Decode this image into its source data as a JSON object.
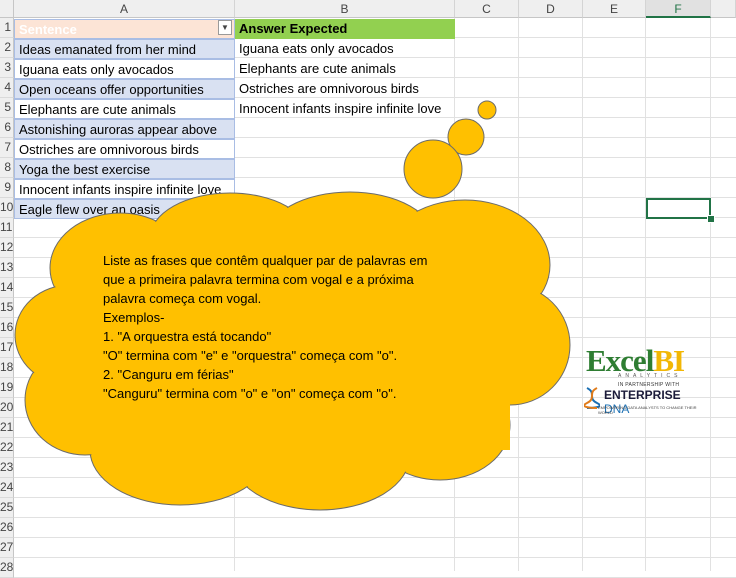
{
  "columns": [
    "A",
    "B",
    "C",
    "D",
    "E",
    "F"
  ],
  "selected_column": "F",
  "rows": [
    "1",
    "2",
    "3",
    "4",
    "5",
    "6",
    "7",
    "8",
    "9",
    "10",
    "11",
    "12",
    "13",
    "14",
    "15",
    "16",
    "17",
    "18",
    "19",
    "20",
    "21",
    "22",
    "23",
    "24",
    "25",
    "26",
    "27",
    "28"
  ],
  "table": {
    "header_a": "Sentence",
    "header_b": "Answer Expected",
    "sentences": [
      "Ideas emanated from her mind",
      "Iguana eats only avocados",
      "Open oceans offer opportunities",
      "Elephants are cute animals",
      "Astonishing auroras appear above",
      "Ostriches are omnivorous birds",
      "Yoga the best exercise",
      "Innocent infants inspire infinite love",
      "Eagle flew over an oasis"
    ],
    "answers": [
      "Iguana eats only avocados",
      "Elephants are cute animals",
      "Ostriches are omnivorous birds",
      "Innocent infants inspire infinite love"
    ]
  },
  "cloud": {
    "color": "#ffc000",
    "lines": [
      "Liste as frases que contêm qualquer par de palavras em",
      "que a primeira palavra termina com vogal e a próxima",
      "palavra começa com vogal.",
      "Exemplos-",
      "1. \"A orquestra está tocando\"",
      "\"O\" termina com \"e\" e \"orquestra\" começa com \"o\".",
      "2. \"Canguru em férias\"",
      "\"Canguru\" termina com \"o\" e \"on\" começa com \"o\"."
    ]
  },
  "logo": {
    "excel": "Excel",
    "bi": "BI",
    "analytics": "ANALYTICS",
    "partnership": "IN PARTNERSHIP WITH",
    "enterprise": "ENTERPRISE",
    "dna": "DNA",
    "tagline": "EMPOWERING DATA ANALYSTS TO CHANGE THEIR WORLD"
  },
  "colors": {
    "sentence_fill": "#d9e1f2",
    "answer_header": "#92d050",
    "selection": "#217346"
  }
}
